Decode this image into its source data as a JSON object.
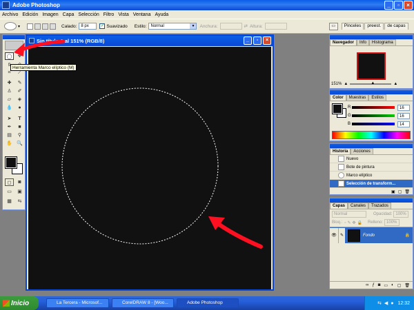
{
  "app": {
    "title": "Adobe Photoshop"
  },
  "menu": [
    "Archivo",
    "Edición",
    "Imagen",
    "Capa",
    "Selección",
    "Filtro",
    "Vista",
    "Ventana",
    "Ayuda"
  ],
  "options": {
    "feather_label": "Calado:",
    "feather_value": "8 px",
    "antialias_label": "Suavizado",
    "style_label": "Estilo:",
    "style_value": "Normal",
    "width_label": "Anchura:",
    "height_label": "Altura:",
    "palette_tab1": "Pinceles",
    "palette_tab2": "preest.",
    "palette_tab3": "de capas"
  },
  "tooltip": "Herramienta Marco elíptico (M)",
  "document": {
    "title": "Sin título-1 al 151% (RGB/8)"
  },
  "navigator": {
    "tabs": [
      "Navegador",
      "Info",
      "Histograma"
    ],
    "zoom": "151%"
  },
  "color": {
    "tabs": [
      "Color",
      "Muestras",
      "Estilos"
    ],
    "channels": [
      {
        "label": "R",
        "value": "16"
      },
      {
        "label": "G",
        "value": "16"
      },
      {
        "label": "B",
        "value": "14"
      }
    ]
  },
  "history": {
    "tabs": [
      "Historia",
      "Acciones"
    ],
    "items": [
      "Nuevo",
      "Bote de pintura",
      "Marco elíptico",
      "Selección de transform..."
    ]
  },
  "layers": {
    "tabs": [
      "Capas",
      "Canales",
      "Trazados"
    ],
    "blend": "Normal",
    "opacity_label": "Opacidad:",
    "opacity": "100%",
    "lock_label": "Bloq.:",
    "fill_label": "Relleno:",
    "fill": "100%",
    "layer_name": "Fondo"
  },
  "taskbar": {
    "start": "Inicio",
    "tasks": [
      "La Tercera - Microsof...",
      "CorelDRAW 8 - [Woo...",
      "Adobe Photoshop"
    ],
    "clock": "12:32"
  },
  "colors": {
    "xp_blue": "#0a5ee8",
    "canvas": "#111111",
    "annotation_red": "#ff1020"
  }
}
